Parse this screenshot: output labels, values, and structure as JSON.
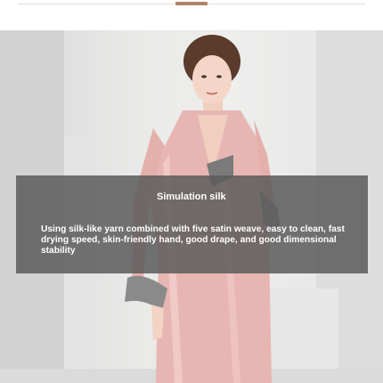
{
  "feature": {
    "title": "Simulation silk",
    "description": "Using silk-like yarn combined with five satin weave, easy to clean, fast drying speed, skin-friendly hand, good drape, and good dimensional stability"
  },
  "colors": {
    "accent": "#b0836a",
    "robe": "#e7b6b2",
    "background": "#ececeb",
    "band": "#5c5c5c"
  }
}
